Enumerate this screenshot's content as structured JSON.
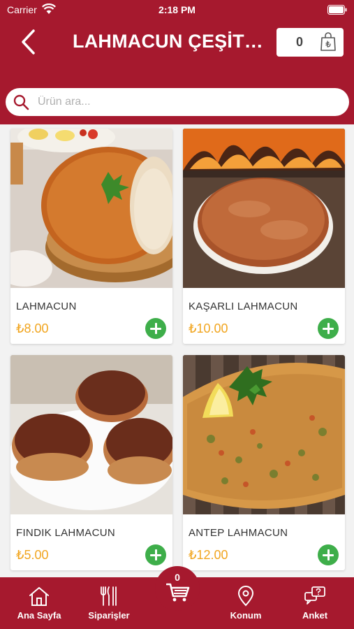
{
  "status_bar": {
    "carrier": "Carrier",
    "time": "2:18 PM"
  },
  "header": {
    "title": "LAHMACUN ÇEŞİTLERİ",
    "cart_count": "0"
  },
  "search": {
    "placeholder": "Ürün ara...",
    "value": ""
  },
  "products": [
    {
      "name": "LAHMACUN",
      "price": "₺8.00"
    },
    {
      "name": "KAŞARLI LAHMACUN",
      "price": "₺10.00"
    },
    {
      "name": "FINDIK LAHMACUN",
      "price": "₺5.00"
    },
    {
      "name": "ANTEP LAHMACUN",
      "price": "₺12.00"
    }
  ],
  "tabbar": {
    "home": "Ana Sayfa",
    "orders": "Siparişler",
    "cart_count": "0",
    "location": "Konum",
    "survey": "Anket"
  },
  "icons": [
    "wifi-icon",
    "battery-icon",
    "back-chevron-icon",
    "shopping-bag-icon",
    "search-icon",
    "plus-icon",
    "home-icon",
    "fork-knife-icon",
    "shopping-cart-icon",
    "location-pin-icon",
    "chat-question-icon"
  ],
  "colors": {
    "brand": "#a6192e",
    "price": "#f1a51f",
    "add": "#3eae4a",
    "background": "#f2f2f2"
  }
}
